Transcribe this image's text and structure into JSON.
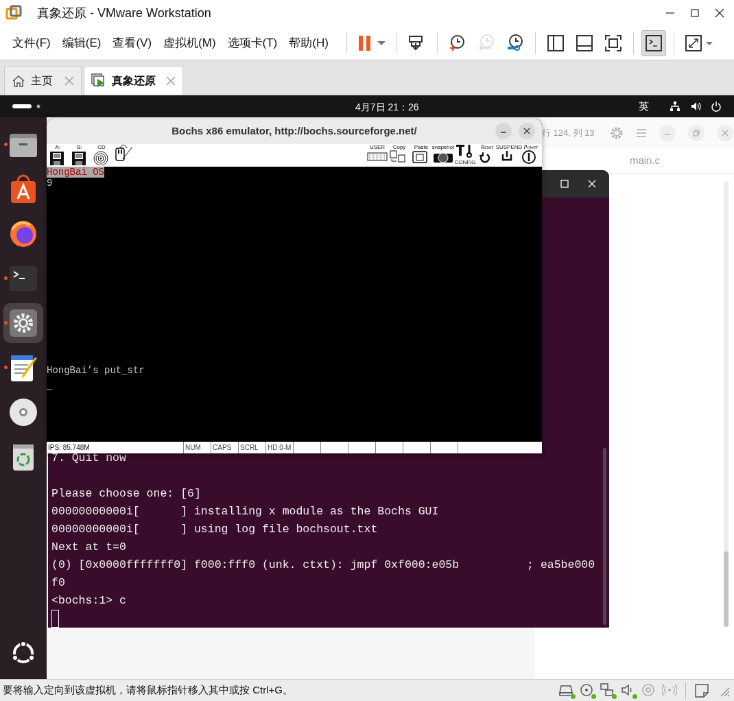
{
  "window": {
    "title": "真象还原 - VMware Workstation"
  },
  "menu": [
    "文件(F)",
    "编辑(E)",
    "查看(V)",
    "虚拟机(M)",
    "选项卡(T)",
    "帮助(H)"
  ],
  "toolbar": [
    [
      {
        "kind": "pause",
        "selected": false,
        "disabled": false
      }
    ],
    [
      {
        "kind": "send-keys",
        "selected": false,
        "disabled": false
      }
    ],
    [
      {
        "kind": "snapshot",
        "selected": false,
        "disabled": false
      },
      {
        "kind": "revert",
        "selected": false,
        "disabled": true
      },
      {
        "kind": "manage",
        "selected": false,
        "disabled": false
      }
    ],
    [
      {
        "kind": "sidebar-view",
        "selected": false,
        "disabled": false
      },
      {
        "kind": "panel-view",
        "selected": false,
        "disabled": false
      },
      {
        "kind": "fullscreen",
        "selected": false,
        "disabled": false
      }
    ],
    [
      {
        "kind": "console",
        "selected": true,
        "disabled": false
      }
    ],
    [
      {
        "kind": "stretch",
        "selected": false,
        "disabled": false
      }
    ]
  ],
  "tabs": [
    {
      "label": "主页",
      "kind": "home",
      "selected": false
    },
    {
      "label": "真象还原",
      "kind": "vm",
      "selected": true
    }
  ],
  "guest": {
    "top_bar": {
      "clock": "4月7日  21：26",
      "input_method": "英"
    },
    "dock": [
      {
        "kind": "files",
        "running": true,
        "selected": false
      },
      {
        "kind": "app-center",
        "running": false,
        "selected": false
      },
      {
        "kind": "browser",
        "running": false,
        "selected": false
      },
      {
        "kind": "terminal",
        "running": true,
        "selected": false
      },
      {
        "kind": "settings",
        "running": true,
        "selected": true
      },
      {
        "kind": "editor",
        "running": true,
        "selected": false
      },
      {
        "kind": "disc",
        "running": false,
        "selected": false
      },
      {
        "kind": "trash",
        "running": false,
        "selected": false
      }
    ],
    "editor": {
      "position": "行 124, 列 13",
      "file": "main.c"
    },
    "terminal": {
      "blocks": [
        [
          "7. Quit now"
        ],
        [
          "Please choose one: [6]",
          "00000000000i[      ] installing x module as the Bochs GUI",
          "00000000000i[      ] using log file bochsout.txt",
          "Next at t=0",
          "(0) [0x0000fffffff0] f000:fff0 (unk. ctxt): jmpf 0xf000:e05b          ; ea5be000",
          "f0",
          "<bochs:1> c"
        ]
      ]
    },
    "bochs": {
      "title": "Bochs x86 emulator, http://bochs.sourceforge.net/",
      "toolbar_left": [
        {
          "label": "A:",
          "kind": "floppy"
        },
        {
          "label": "B:",
          "kind": "floppy"
        },
        {
          "label": "CD",
          "kind": "cdrom"
        },
        {
          "kind": "mouse"
        }
      ],
      "toolbar_right": [
        {
          "label": "USER",
          "kind": "keyboard"
        },
        {
          "label": "Copy",
          "kind": "copy"
        },
        {
          "label": "Paste",
          "kind": "paste"
        },
        {
          "label": "snapshot",
          "kind": "camera"
        },
        {
          "label": "CONFIG",
          "kind": "config"
        },
        {
          "label": "Reset",
          "kind": "reset"
        },
        {
          "label": "SUSPEND",
          "kind": "suspend"
        },
        {
          "label": "Power",
          "kind": "power"
        }
      ],
      "screen": {
        "banner": "HongBai OS",
        "lines": [
          "9"
        ],
        "message": "HongBai’s put_str",
        "cursor": "_"
      },
      "status": [
        "IPS: 85.748M",
        "NUM",
        "CAPS",
        "SCRL",
        "HD:0-M"
      ]
    }
  },
  "status_bar": {
    "message": "要将输入定向到该虚拟机，请将鼠标指针移入其中或按 Ctrl+G。",
    "devices": [
      {
        "kind": "hdd",
        "connected": true
      },
      {
        "kind": "cd",
        "connected": true
      },
      {
        "kind": "network",
        "connected": true
      },
      {
        "kind": "sound",
        "connected": true
      },
      {
        "kind": "camera",
        "connected": false
      },
      {
        "kind": "wireless",
        "connected": false
      }
    ]
  }
}
